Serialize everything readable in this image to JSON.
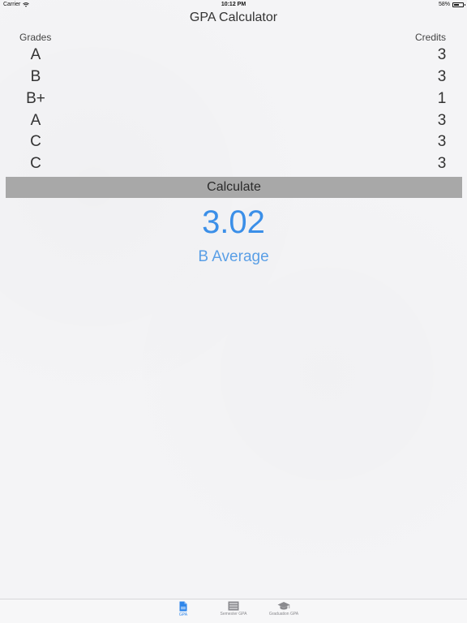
{
  "status_bar": {
    "carrier": "Carrier",
    "time": "10:12 PM",
    "battery_percent": "58%",
    "battery_level": 0.58
  },
  "title": "GPA Calculator",
  "headers": {
    "grades": "Grades",
    "credits": "Credits"
  },
  "rows": [
    {
      "grade": "A",
      "credits": "3"
    },
    {
      "grade": "B",
      "credits": "3"
    },
    {
      "grade": "B+",
      "credits": "1"
    },
    {
      "grade": "A",
      "credits": "3"
    },
    {
      "grade": "C",
      "credits": "3"
    },
    {
      "grade": "C",
      "credits": "3"
    }
  ],
  "calculate_label": "Calculate",
  "result": {
    "gpa": "3.02",
    "average": "B Average"
  },
  "tabs": [
    {
      "label": "GPA",
      "icon": "document-icon",
      "active": true
    },
    {
      "label": "Semester GPA",
      "icon": "list-icon",
      "active": false
    },
    {
      "label": "Graduation GPA",
      "icon": "graduation-cap-icon",
      "active": false
    }
  ],
  "colors": {
    "accent": "#3b8fe8",
    "button_bg": "#a8a8a8"
  }
}
